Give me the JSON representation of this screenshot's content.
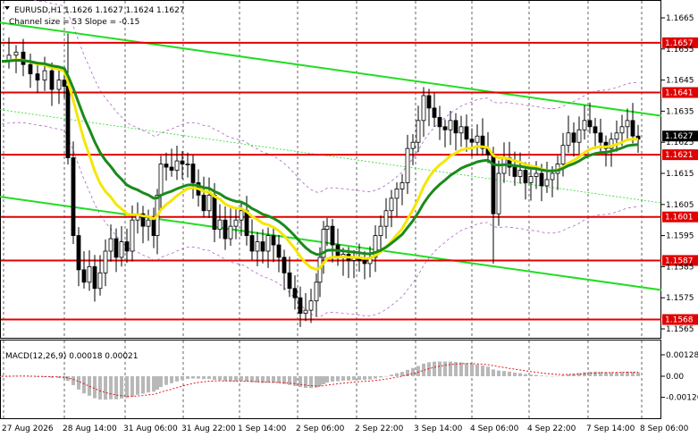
{
  "header": {
    "symbol_line": "EURUSD,H1  1.1626 1.1627 1.1624 1.1627",
    "channel_line": "Channel size = 53 Slope = -0.15",
    "macd_label": "MACD(12,26,9) 0.00018 0.00021"
  },
  "chart_data": [
    {
      "type": "candlestick",
      "title": "EURUSD,H1",
      "ohlc_last": {
        "open": 1.1626,
        "high": 1.1627,
        "low": 1.1624,
        "close": 1.1627
      },
      "ylim": [
        1.1557,
        1.1675
      ],
      "y_ticks": [
        "1.1665",
        "1.1655",
        "1.1645",
        "1.1635",
        "1.1625",
        "1.1615",
        "1.1605",
        "1.1595",
        "1.1585",
        "1.1575",
        "1.1565"
      ],
      "x_ticks": [
        "27 Aug 2026",
        "28 Aug 14:00",
        "31 Aug 06:00",
        "31 Aug 22:00",
        "1 Sep 14:00",
        "2 Sep 06:00",
        "2 Sep 22:00",
        "3 Sep 14:00",
        "4 Sep 06:00",
        "4 Sep 22:00",
        "7 Sep 14:00",
        "8 Sep 06:00"
      ],
      "levels": [
        {
          "label": "1.1657",
          "value": 1.1657,
          "color": "#e00000"
        },
        {
          "label": "1.1641",
          "value": 1.1641,
          "color": "#e00000"
        },
        {
          "label": "1.1621",
          "value": 1.1621,
          "color": "#e00000"
        },
        {
          "label": "1.1601",
          "value": 1.1601,
          "color": "#e00000"
        },
        {
          "label": "1.1587",
          "value": 1.1587,
          "color": "#e00000"
        },
        {
          "label": "1.1568",
          "value": 1.1568,
          "color": "#e00000"
        }
      ],
      "current_price": {
        "label": "1.1627",
        "value": 1.1627
      },
      "channel": {
        "size": 53,
        "slope": -0.15,
        "color": "#22dd22"
      },
      "moving_averages": [
        {
          "color": "#f5e600",
          "role": "fast"
        },
        {
          "color": "#1a8a1a",
          "role": "slow"
        }
      ]
    },
    {
      "type": "histogram",
      "title": "MACD(12,26,9)",
      "values": {
        "macd": 0.00018,
        "signal": 0.00021
      },
      "y_ticks": [
        "0.00128",
        "0.00",
        "-0.00126"
      ],
      "signal_color": "#e00000",
      "bar_color": "#b8b8b8"
    }
  ],
  "icons": {
    "header": "down-triangle-icon"
  }
}
